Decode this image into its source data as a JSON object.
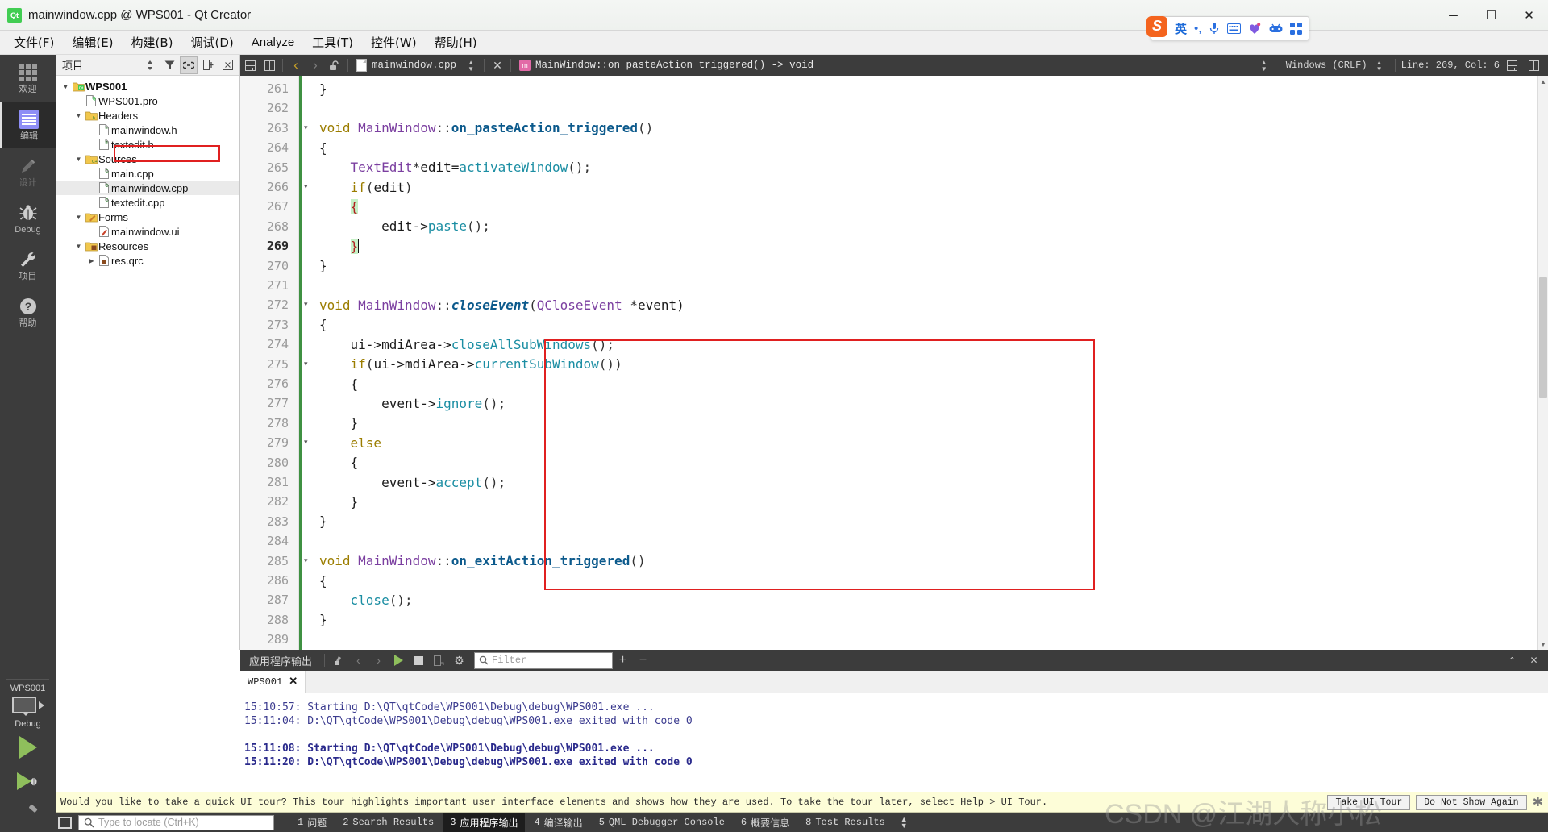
{
  "window": {
    "title": "mainwindow.cpp @ WPS001 - Qt Creator",
    "logo_text": "Qt",
    "minimize": "─",
    "maximize": "☐",
    "close": "✕"
  },
  "menubar": [
    {
      "label": "文件(F)"
    },
    {
      "label": "编辑(E)"
    },
    {
      "label": "构建(B)"
    },
    {
      "label": "调试(D)"
    },
    {
      "label": "Analyze"
    },
    {
      "label": "工具(T)"
    },
    {
      "label": "控件(W)"
    },
    {
      "label": "帮助(H)"
    }
  ],
  "ime": {
    "logo": "S",
    "mode": "英",
    "punct": "•,",
    "mic": "🎤",
    "keyboard": "⌨",
    "skin": "skin-icon",
    "game": "game-icon",
    "apps": "apps-icon"
  },
  "modebar": {
    "items": [
      {
        "label": "欢迎",
        "icon": "grid-icon",
        "state": "normal"
      },
      {
        "label": "编辑",
        "icon": "edit-icon",
        "state": "active"
      },
      {
        "label": "设计",
        "icon": "pencil-icon",
        "state": "disabled"
      },
      {
        "label": "Debug",
        "icon": "bug-icon",
        "state": "normal"
      },
      {
        "label": "项目",
        "icon": "wrench-icon",
        "state": "normal"
      },
      {
        "label": "帮助",
        "icon": "question-icon",
        "state": "normal"
      }
    ],
    "kit": {
      "project": "WPS001",
      "build_config": "Debug",
      "run_label": "run-button",
      "debug_label": "run-debug-button",
      "build_label": "build-button"
    }
  },
  "project_panel": {
    "title": "项目",
    "header_buttons": [
      "sort-icon",
      "filter-icon",
      "link-icon",
      "split-icon",
      "close-icon"
    ],
    "tree": [
      {
        "depth": 0,
        "arrow": "▼",
        "icon": "folder-qt",
        "label": "WPS001",
        "bold": true,
        "selected": false
      },
      {
        "depth": 1,
        "arrow": "",
        "icon": "file-pro",
        "label": "WPS001.pro",
        "bold": false,
        "selected": false
      },
      {
        "depth": 1,
        "arrow": "▼",
        "icon": "folder-h",
        "label": "Headers",
        "bold": false,
        "selected": false
      },
      {
        "depth": 2,
        "arrow": "",
        "icon": "file-h",
        "label": "mainwindow.h",
        "bold": false,
        "selected": false
      },
      {
        "depth": 2,
        "arrow": "",
        "icon": "file-h",
        "label": "textedit.h",
        "bold": false,
        "selected": false
      },
      {
        "depth": 1,
        "arrow": "▼",
        "icon": "folder-cpp",
        "label": "Sources",
        "bold": false,
        "selected": false
      },
      {
        "depth": 2,
        "arrow": "",
        "icon": "file-cpp",
        "label": "main.cpp",
        "bold": false,
        "selected": false
      },
      {
        "depth": 2,
        "arrow": "",
        "icon": "file-cpp",
        "label": "mainwindow.cpp",
        "bold": false,
        "selected": true
      },
      {
        "depth": 2,
        "arrow": "",
        "icon": "file-cpp",
        "label": "textedit.cpp",
        "bold": false,
        "selected": false
      },
      {
        "depth": 1,
        "arrow": "▼",
        "icon": "folder-ui",
        "label": "Forms",
        "bold": false,
        "selected": false
      },
      {
        "depth": 2,
        "arrow": "",
        "icon": "file-ui",
        "label": "mainwindow.ui",
        "bold": false,
        "selected": false
      },
      {
        "depth": 1,
        "arrow": "▼",
        "icon": "folder-res",
        "label": "Resources",
        "bold": false,
        "selected": false
      },
      {
        "depth": 2,
        "arrow": "▶",
        "icon": "file-qrc",
        "label": "res.qrc",
        "bold": false,
        "selected": false
      }
    ]
  },
  "editor_toolbar": {
    "document": "mainwindow.cpp",
    "symbol": "MainWindow::on_pasteAction_triggered() -> void",
    "close_label": "✕",
    "line_ending": "Windows (CRLF)",
    "position": "Line: 269, Col: 6",
    "back_label": "‹",
    "forward_label": "›",
    "lock_label": "unlocked-icon",
    "split_label": "split-icon",
    "split_side_label": "split-side-icon"
  },
  "code": {
    "first_line": 261,
    "current_line": 269,
    "lines": [
      {
        "n": 261,
        "fold": "",
        "html": "<span class='k-txt'>}</span>"
      },
      {
        "n": 262,
        "fold": "",
        "html": ""
      },
      {
        "n": 263,
        "fold": "▾",
        "html": "<span class='k-kw'>void</span> <span class='k-type'>MainWindow</span><span class='k-op'>::</span><span class='k-fn'>on_pasteAction_triggered</span><span class='k-op'>()</span>"
      },
      {
        "n": 264,
        "fold": "",
        "html": "<span class='k-txt'>{</span>"
      },
      {
        "n": 265,
        "fold": "",
        "html": "    <span class='k-type'>TextEdit</span><span class='k-op'>*</span><span class='k-txt'>edit=</span><span class='k-call'>activateWindow</span><span class='k-op'>();</span>"
      },
      {
        "n": 266,
        "fold": "▾",
        "html": "    <span class='k-kw'>if</span><span class='k-op'>(</span><span class='k-txt'>edit</span><span class='k-op'>)</span>"
      },
      {
        "n": 267,
        "fold": "",
        "html": "    <span class='brace-hl'>{</span>"
      },
      {
        "n": 268,
        "fold": "",
        "html": "        <span class='k-txt'>edit-&gt;</span><span class='k-call'>paste</span><span class='k-op'>();</span>"
      },
      {
        "n": 269,
        "fold": "",
        "html": "    <span class='brace-hl'>}</span><span class='caret'></span>"
      },
      {
        "n": 270,
        "fold": "",
        "html": "<span class='k-txt'>}</span>"
      },
      {
        "n": 271,
        "fold": "",
        "html": ""
      },
      {
        "n": 272,
        "fold": "▾",
        "html": "<span class='k-kw'>void</span> <span class='k-type'>MainWindow</span><span class='k-op'>::</span><span class='k-fn-i'>closeEvent</span><span class='k-op'>(</span><span class='k-type'>QCloseEvent</span> <span class='k-op'>*</span><span class='k-txt'>event)</span>"
      },
      {
        "n": 273,
        "fold": "",
        "html": "<span class='k-txt'>{</span>"
      },
      {
        "n": 274,
        "fold": "",
        "html": "    <span class='k-txt'>ui-&gt;</span><span class='k-txt'>mdiArea-&gt;</span><span class='k-call'>closeAllSubWindows</span><span class='k-op'>();</span>"
      },
      {
        "n": 275,
        "fold": "▾",
        "html": "    <span class='k-kw'>if</span><span class='k-op'>(</span><span class='k-txt'>ui-&gt;mdiArea-&gt;</span><span class='k-call'>currentSubWindow</span><span class='k-op'>())</span>"
      },
      {
        "n": 276,
        "fold": "",
        "html": "    <span class='k-txt'>{</span>"
      },
      {
        "n": 277,
        "fold": "",
        "html": "        <span class='k-txt'>event-&gt;</span><span class='k-call'>ignore</span><span class='k-op'>();</span>"
      },
      {
        "n": 278,
        "fold": "",
        "html": "    <span class='k-txt'>}</span>"
      },
      {
        "n": 279,
        "fold": "▾",
        "html": "    <span class='k-kw'>else</span>"
      },
      {
        "n": 280,
        "fold": "",
        "html": "    <span class='k-txt'>{</span>"
      },
      {
        "n": 281,
        "fold": "",
        "html": "        <span class='k-txt'>event-&gt;</span><span class='k-call'>accept</span><span class='k-op'>();</span>"
      },
      {
        "n": 282,
        "fold": "",
        "html": "    <span class='k-txt'>}</span>"
      },
      {
        "n": 283,
        "fold": "",
        "html": "<span class='k-txt'>}</span>"
      },
      {
        "n": 284,
        "fold": "",
        "html": ""
      },
      {
        "n": 285,
        "fold": "▾",
        "html": "<span class='k-kw'>void</span> <span class='k-type'>MainWindow</span><span class='k-op'>::</span><span class='k-fn'>on_exitAction_triggered</span><span class='k-op'>()</span>"
      },
      {
        "n": 286,
        "fold": "",
        "html": "<span class='k-txt'>{</span>"
      },
      {
        "n": 287,
        "fold": "",
        "html": "    <span class='k-call'>close</span><span class='k-op'>();</span>"
      },
      {
        "n": 288,
        "fold": "",
        "html": "<span class='k-txt'>}</span>"
      },
      {
        "n": 289,
        "fold": "",
        "html": ""
      }
    ]
  },
  "output": {
    "title": "应用程序输出",
    "filter_placeholder": "Filter",
    "buttons": [
      "clean-icon",
      "prev-icon",
      "next-icon",
      "run-icon",
      "stop-icon",
      "attach-icon",
      "settings-icon"
    ],
    "zoom_in": "+",
    "zoom_out": "−",
    "maximize": "⌃",
    "close": "✕",
    "tabs": [
      {
        "label": "WPS001",
        "close": "✕"
      }
    ],
    "log": [
      {
        "text": "15:10:57: Starting D:\\QT\\qtCode\\WPS001\\Debug\\debug\\WPS001.exe ...",
        "bold": false
      },
      {
        "text": "15:11:04: D:\\QT\\qtCode\\WPS001\\Debug\\debug\\WPS001.exe exited with code 0",
        "bold": false
      },
      {
        "text": "",
        "bold": false
      },
      {
        "text": "15:11:08: Starting D:\\QT\\qtCode\\WPS001\\Debug\\debug\\WPS001.exe ...",
        "bold": true
      },
      {
        "text": "15:11:20: D:\\QT\\qtCode\\WPS001\\Debug\\debug\\WPS001.exe exited with code 0",
        "bold": true
      }
    ]
  },
  "tour": {
    "message": "Would you like to take a quick UI tour? This tour highlights important user interface elements and shows how they are used. To take the tour later, select Help > UI Tour.",
    "take_button": "Take UI Tour",
    "dismiss_button": "Do Not Show Again"
  },
  "statusbar": {
    "locator_placeholder": "Type to locate (Ctrl+K)",
    "tabs": [
      {
        "num": "1",
        "label": "问题",
        "active": false
      },
      {
        "num": "2",
        "label": "Search Results",
        "active": false
      },
      {
        "num": "3",
        "label": "应用程序输出",
        "active": true
      },
      {
        "num": "4",
        "label": "编译输出",
        "active": false
      },
      {
        "num": "5",
        "label": "QML Debugger Console",
        "active": false
      },
      {
        "num": "6",
        "label": "概要信息",
        "active": false
      },
      {
        "num": "8",
        "label": "Test Results",
        "active": false
      }
    ]
  },
  "watermark": "CSDN @江湖人称小松"
}
